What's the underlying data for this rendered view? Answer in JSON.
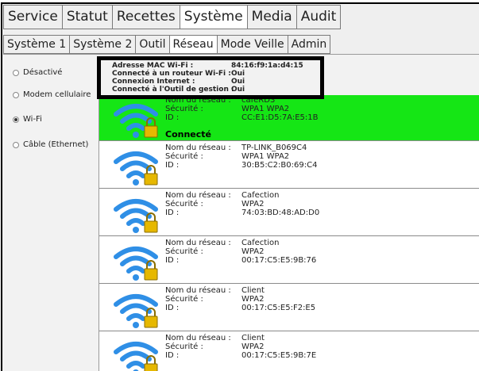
{
  "main_tabs": [
    "Service",
    "Statut",
    "Recettes",
    "Système",
    "Media",
    "Audit"
  ],
  "sub_tabs": [
    "Système 1",
    "Système 2",
    "Outil",
    "Réseau",
    "Mode Veille",
    "Admin"
  ],
  "connection_types": [
    {
      "label": "Désactivé",
      "checked": false
    },
    {
      "label": "Modem cellulaire",
      "checked": false
    },
    {
      "label": "Wi-Fi",
      "checked": true
    },
    {
      "label": "Câble (Ethernet)",
      "checked": false
    }
  ],
  "wifi_info": {
    "mac_label": "Adresse MAC Wi-Fi :",
    "mac_value": "84:16:f9:1a:d4:15",
    "router_label": "Connecté à un routeur Wi-Fi :",
    "router_value": "Oui",
    "internet_label": "Connexion Internet :",
    "internet_value": "Oui",
    "tool_label": "Connecté à l'Outil de gestion :",
    "tool_value": "Oui"
  },
  "labels": {
    "network": "Nom du réseau :",
    "security": "Sécurité :",
    "id": "ID :"
  },
  "colors": {
    "connected_bg": "#15e615",
    "wifi_blue": "#2f8fe6",
    "lock_gold": "#e6b800"
  },
  "networks": [
    {
      "name": "cafeRD3",
      "security": "WPA1 WPA2",
      "id": "CC:E1:D5:7A:E5:1B",
      "status": "Connecté",
      "connected": true
    },
    {
      "name": "TP-LINK_B069C4",
      "security": "WPA1 WPA2",
      "id": "30:B5:C2:B0:69:C4",
      "status": "",
      "connected": false
    },
    {
      "name": "Cafection",
      "security": "WPA2",
      "id": "74:03:BD:48:AD:D0",
      "status": "",
      "connected": false
    },
    {
      "name": "Cafection",
      "security": "WPA2",
      "id": "00:17:C5:E5:9B:76",
      "status": "",
      "connected": false
    },
    {
      "name": "Client",
      "security": "WPA2",
      "id": "00:17:C5:E5:F2:E5",
      "status": "",
      "connected": false
    },
    {
      "name": "Client",
      "security": "WPA2",
      "id": "00:17:C5:E5:9B:7E",
      "status": "",
      "connected": false
    }
  ]
}
